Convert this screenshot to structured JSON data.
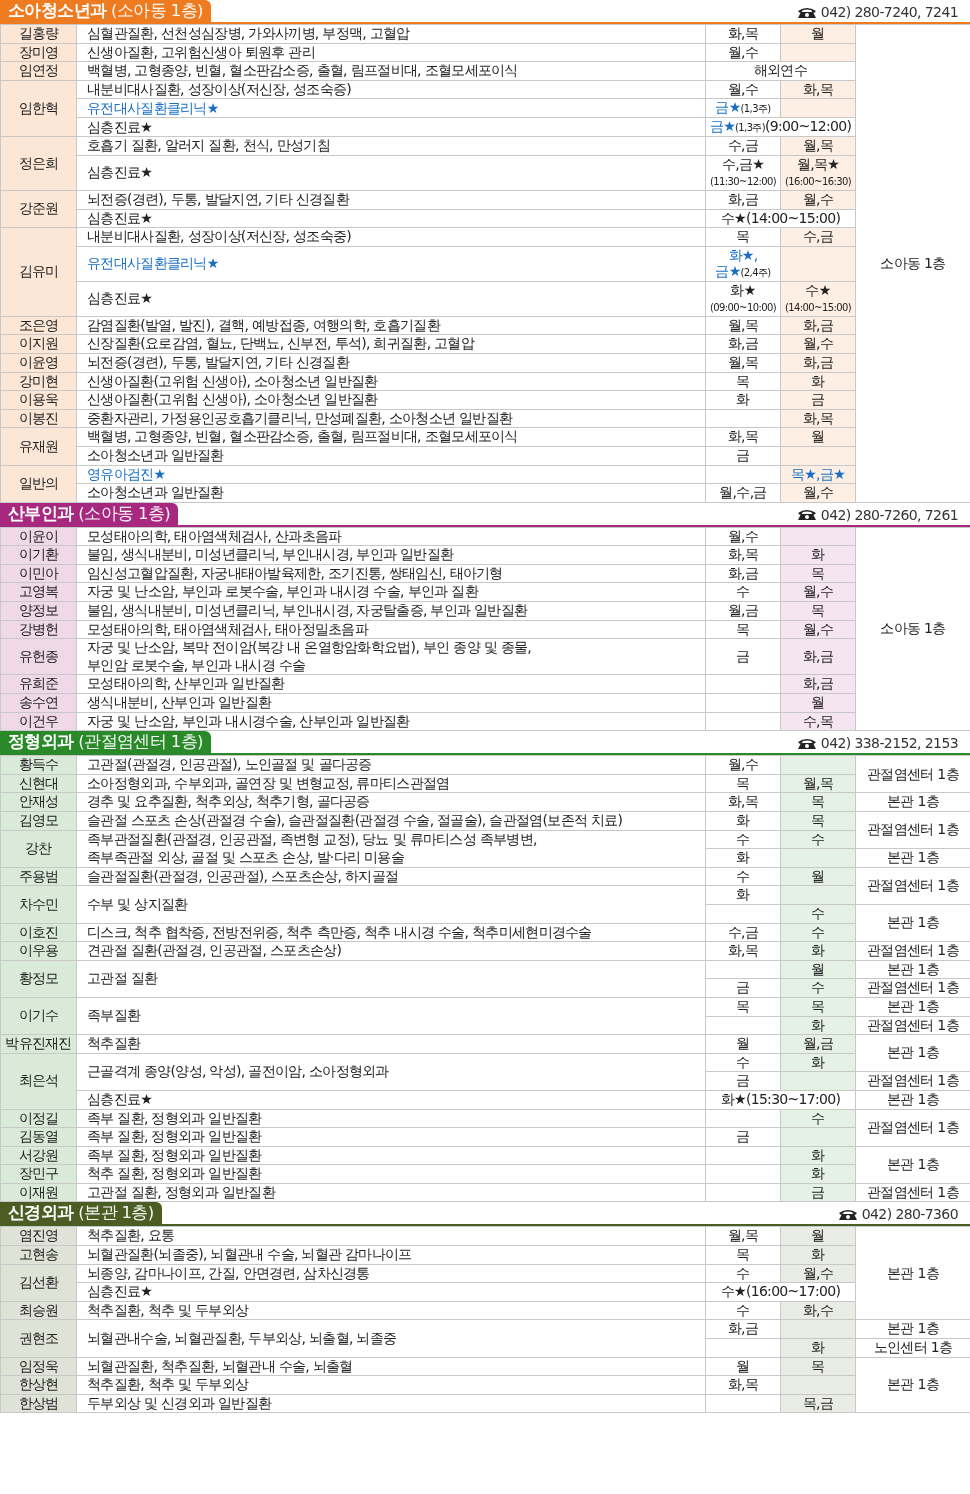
{
  "sections": [
    {
      "title": "소아청소년과",
      "floor": "(소아동 1층)",
      "phone": "042) 280-7240, 7241",
      "color": "#ef7b21",
      "doctors": [
        {
          "name": "길홍량",
          "topics": [
            {
              "text": "심혈관질환, 선천성심장병, 가와사끼병, 부정맥, 고혈압",
              "clinic": false,
              "slots": [
                {
                  "am": "화,목",
                  "pm": "월",
                  "location": "소아동 1층"
                }
              ]
            }
          ]
        },
        {
          "name": "장미영",
          "topics": [
            {
              "text": "신생아질환, 고위험신생아 퇴원후 관리",
              "clinic": false,
              "slots": [
                {
                  "am": "월,수"
                }
              ]
            }
          ]
        },
        {
          "name": "임연정",
          "topics": [
            {
              "text": "백혈병, 고형종양, 빈혈, 혈소판감소증, 출혈, 림프절비대, 조혈모세포이식",
              "clinic": false,
              "slots": [
                {
                  "both": "해외연수"
                }
              ]
            }
          ]
        },
        {
          "name": "임한혁",
          "topics": [
            {
              "text": "내분비대사질환, 성장이상(저신장, 성조숙증)",
              "clinic": false,
              "slots": [
                {
                  "am": "월,수",
                  "pm": "화,목"
                }
              ]
            },
            {
              "text": "유전대사질환클리닉★",
              "clinic": true,
              "slots": [
                {
                  "am": {
                    "lines": [
                      [
                        {
                          "text": "금★",
                          "kind": "blue"
                        },
                        {
                          "text": "(1,3주)",
                          "kind": "note"
                        }
                      ]
                    ]
                  }
                }
              ]
            },
            {
              "text": "심층진료★",
              "clinic": false,
              "slots": [
                {
                  "both": {
                    "lines": [
                      [
                        {
                          "text": "금★",
                          "kind": "blue"
                        },
                        {
                          "text": "(1,3주)",
                          "kind": "note"
                        },
                        {
                          "text": "(9:00~12:00)",
                          "kind": "plain"
                        }
                      ]
                    ]
                  }
                }
              ]
            }
          ]
        },
        {
          "name": "정은희",
          "topics": [
            {
              "text": "호흡기 질환, 알러지 질환, 천식, 만성기침",
              "clinic": false,
              "slots": [
                {
                  "am": "수,금",
                  "pm": "월,목"
                }
              ]
            },
            {
              "text": "심층진료★",
              "clinic": false,
              "slots": [
                {
                  "am": {
                    "lines": [
                      [
                        {
                          "text": "수,금★",
                          "kind": "plain"
                        }
                      ],
                      [
                        {
                          "text": "(11:30~12:00)",
                          "kind": "note"
                        }
                      ]
                    ]
                  },
                  "pm": {
                    "lines": [
                      [
                        {
                          "text": "월,목★",
                          "kind": "plain"
                        }
                      ],
                      [
                        {
                          "text": "(16:00~16:30)",
                          "kind": "note"
                        }
                      ]
                    ]
                  }
                }
              ]
            }
          ]
        },
        {
          "name": "강준원",
          "topics": [
            {
              "text": "뇌전증(경련), 두통, 발달지연, 기타 신경질환",
              "clinic": false,
              "slots": [
                {
                  "am": "화,금",
                  "pm": "월,수"
                }
              ]
            },
            {
              "text": "심층진료★",
              "clinic": false,
              "slots": [
                {
                  "both": "수★(14:00~15:00)"
                }
              ]
            }
          ]
        },
        {
          "name": "김유미",
          "topics": [
            {
              "text": "내분비대사질환, 성장이상(저신장, 성조숙중)",
              "clinic": false,
              "slots": [
                {
                  "am": "목",
                  "pm": "수,금"
                }
              ]
            },
            {
              "text": "유전대사질환클리닉★",
              "clinic": true,
              "slots": [
                {
                  "am": {
                    "lines": [
                      [
                        {
                          "text": "화★,",
                          "kind": "blue"
                        }
                      ],
                      [
                        {
                          "text": "금★",
                          "kind": "blue"
                        },
                        {
                          "text": "(2,4주)",
                          "kind": "note"
                        }
                      ]
                    ]
                  }
                }
              ]
            },
            {
              "text": "심층진료★",
              "clinic": false,
              "slots": [
                {
                  "am": {
                    "lines": [
                      [
                        {
                          "text": "화★",
                          "kind": "plain"
                        }
                      ],
                      [
                        {
                          "text": "(09:00~10:00)",
                          "kind": "note"
                        }
                      ]
                    ]
                  },
                  "pm": {
                    "lines": [
                      [
                        {
                          "text": "수★",
                          "kind": "plain"
                        }
                      ],
                      [
                        {
                          "text": "(14:00~15:00)",
                          "kind": "note"
                        }
                      ]
                    ]
                  }
                }
              ]
            }
          ]
        },
        {
          "name": "조은영",
          "topics": [
            {
              "text": "감염질환(발열, 발진), 결핵, 예방접종, 여행의학, 호흡기질환",
              "clinic": false,
              "slots": [
                {
                  "am": "월,목",
                  "pm": "화,금"
                }
              ]
            }
          ]
        },
        {
          "name": "이지원",
          "topics": [
            {
              "text": "신장질환(요로감염, 혈뇨, 단백뇨, 신부전, 투석), 희귀질환, 고혈압",
              "clinic": false,
              "slots": [
                {
                  "am": "화,금",
                  "pm": "월,수"
                }
              ]
            }
          ]
        },
        {
          "name": "이윤영",
          "topics": [
            {
              "text": "뇌전증(경련), 두통, 발달지연, 기타 신경질환",
              "clinic": false,
              "slots": [
                {
                  "am": "월,목",
                  "pm": "화,금"
                }
              ]
            }
          ]
        },
        {
          "name": "강미현",
          "topics": [
            {
              "text": "신생아질환(고위험 신생아), 소아청소년 일반질환",
              "clinic": false,
              "slots": [
                {
                  "am": "목",
                  "pm": "화"
                }
              ]
            }
          ]
        },
        {
          "name": "이용욱",
          "topics": [
            {
              "text": "신생아질환(고위험 신생아), 소아청소년 일반질환",
              "clinic": false,
              "slots": [
                {
                  "am": "화",
                  "pm": "금"
                }
              ]
            }
          ]
        },
        {
          "name": "이봉진",
          "topics": [
            {
              "text": "중환자관리, 가정용인공호흡기클리닉, 만성폐질환, 소아청소년 일반질환",
              "clinic": false,
              "slots": [
                {
                  "pm": "화,목"
                }
              ]
            }
          ]
        },
        {
          "name": "유재원",
          "topics": [
            {
              "text": "백혈병, 고형종양, 빈혈, 혈소판감소증, 출혈, 림프절비대, 조혈모세포이식",
              "clinic": false,
              "slots": [
                {
                  "am": "화,목",
                  "pm": "월"
                }
              ]
            },
            {
              "text": "소아청소년과 일반질환",
              "clinic": false,
              "slots": [
                {
                  "am": "금"
                }
              ]
            }
          ]
        },
        {
          "name": "일반의",
          "topics": [
            {
              "text": "영유아검진★",
              "clinic": true,
              "slots": [
                {
                  "pm": {
                    "lines": [
                      [
                        {
                          "text": "목★,금★",
                          "kind": "blue"
                        }
                      ]
                    ]
                  }
                }
              ]
            },
            {
              "text": "소아청소년과 일반질환",
              "clinic": false,
              "slots": [
                {
                  "am": "월,수,금",
                  "pm": "월,수"
                }
              ]
            }
          ]
        }
      ]
    },
    {
      "title": "산부인과",
      "floor": "(소아동 1층)",
      "phone": "042) 280-7260, 7261",
      "color": "#a6297f",
      "doctors": [
        {
          "name": "이윤이",
          "topics": [
            {
              "text": "모성태아의학, 태아염색체검사, 산과초음파",
              "clinic": false,
              "slots": [
                {
                  "am": "월,수",
                  "location": "소아동 1층"
                }
              ]
            }
          ]
        },
        {
          "name": "이기환",
          "topics": [
            {
              "text": "불임, 생식내분비, 미성년클리닉, 부인내시경, 부인과 일반질환",
              "clinic": false,
              "slots": [
                {
                  "am": "화,목",
                  "pm": "화"
                }
              ]
            }
          ]
        },
        {
          "name": "이민아",
          "topics": [
            {
              "text": "임신성고혈압질환, 자궁내태아발육제한, 조기진통, 쌍태임신, 태아기형",
              "clinic": false,
              "slots": [
                {
                  "am": "화,금",
                  "pm": "목"
                }
              ]
            }
          ]
        },
        {
          "name": "고영복",
          "topics": [
            {
              "text": "자궁 및 난소암, 부인과 로봇수술, 부인과 내시경 수술, 부인과 질환",
              "clinic": false,
              "slots": [
                {
                  "am": "수",
                  "pm": "월,수"
                }
              ]
            }
          ]
        },
        {
          "name": "양정보",
          "topics": [
            {
              "text": "불임, 생식내분비, 미성년클리닉, 부인내시경, 자궁탈출증, 부인과 일반질환",
              "clinic": false,
              "slots": [
                {
                  "am": "월,금",
                  "pm": "목"
                }
              ]
            }
          ]
        },
        {
          "name": "강병헌",
          "topics": [
            {
              "text": "모성태아의학, 태아염색체검사, 태아정밀초음파",
              "clinic": false,
              "slots": [
                {
                  "am": "목",
                  "pm": "월,수"
                }
              ]
            }
          ]
        },
        {
          "name": "유헌종",
          "topics": [
            {
              "text": "자궁 및 난소암, 복막 전이암(복강 내 온열항암화학요법), 부인 종양 및 종물,\n부인암 로봇수술, 부인과 내시경 수술",
              "clinic": false,
              "slots": [
                {
                  "am": "금",
                  "pm": "화,금"
                }
              ]
            }
          ]
        },
        {
          "name": "유희준",
          "topics": [
            {
              "text": "모성태아의학, 산부인과 일반질환",
              "clinic": false,
              "slots": [
                {
                  "pm": "화,금"
                }
              ]
            }
          ]
        },
        {
          "name": "송수연",
          "topics": [
            {
              "text": "생식내분비, 산부인과 일반질환",
              "clinic": false,
              "slots": [
                {
                  "pm": "월"
                }
              ]
            }
          ]
        },
        {
          "name": "이건우",
          "topics": [
            {
              "text": "자궁 및 난소암, 부인과 내시경수술, 산부인과 일반질환",
              "clinic": false,
              "slots": [
                {
                  "pm": "수,목"
                }
              ]
            }
          ]
        }
      ]
    },
    {
      "title": "정형외과",
      "floor": "(관절염센터 1층)",
      "phone": "042) 338-2152, 2153",
      "color": "#2a8a2a",
      "doctors": [
        {
          "name": "황득수",
          "topics": [
            {
              "text": "고관절(관절경, 인공관절), 노인골절 및 골다공증",
              "clinic": false,
              "slots": [
                {
                  "am": "월,수",
                  "location": "관절염센터 1층"
                }
              ]
            }
          ]
        },
        {
          "name": "신현대",
          "topics": [
            {
              "text": "소아정형외과, 수부외과, 골연장 및 변형교정, 류마티스관절염",
              "clinic": false,
              "slots": [
                {
                  "am": "목",
                  "pm": "월,목"
                }
              ]
            }
          ]
        },
        {
          "name": "안재성",
          "topics": [
            {
              "text": "경추 및 요추질환, 척추외상, 척추기형, 골다공증",
              "clinic": false,
              "slots": [
                {
                  "am": "화,목",
                  "pm": "목",
                  "location": "본관 1층"
                }
              ]
            }
          ]
        },
        {
          "name": "김영모",
          "topics": [
            {
              "text": "슬관절 스포츠 손상(관절경 수술), 슬관절질환(관절경 수술, 절골술), 슬관절염(보존적 치료)",
              "clinic": false,
              "slots": [
                {
                  "am": "화",
                  "pm": "목",
                  "location": "관절염센터 1층"
                }
              ]
            }
          ]
        },
        {
          "name": "강찬",
          "topics": [
            {
              "text": "족부관절질환(관절경, 인공관절, 족변형 교정), 당뇨 및 류마티스성 족부병변,\n족부족관절 외상, 골절 및 스포츠 손상, 발·다리 미용술",
              "clinic": false,
              "slots": [
                {
                  "am": "수",
                  "pm": "수"
                },
                {
                  "am": "화",
                  "location": "본관 1층"
                }
              ]
            }
          ]
        },
        {
          "name": "주용범",
          "topics": [
            {
              "text": "슬관절질환(관절경, 인공관절), 스포츠손상, 하지골절",
              "clinic": false,
              "slots": [
                {
                  "am": "수",
                  "pm": "월",
                  "location": "관절염센터 1층"
                }
              ]
            }
          ]
        },
        {
          "name": "차수민",
          "topics": [
            {
              "text": "수부 및 상지질환",
              "clinic": false,
              "slots": [
                {
                  "am": "화"
                },
                {
                  "pm": "수",
                  "location": "본관 1층"
                }
              ]
            }
          ]
        },
        {
          "name": "이호진",
          "topics": [
            {
              "text": "디스크, 척추 협착증, 전방전위증, 척추 측만증, 척추 내시경 수술, 척추미세현미경수술",
              "clinic": false,
              "slots": [
                {
                  "am": "수,금",
                  "pm": "수"
                }
              ]
            }
          ]
        },
        {
          "name": "이우용",
          "topics": [
            {
              "text": "견관절 질환(관절경, 인공관절, 스포츠손상)",
              "clinic": false,
              "slots": [
                {
                  "am": "화,목",
                  "pm": "화",
                  "location": "관절염센터 1층"
                }
              ]
            }
          ]
        },
        {
          "name": "황정모",
          "topics": [
            {
              "text": "고관절 질환",
              "clinic": false,
              "slots": [
                {
                  "pm": "월",
                  "location": "본관 1층"
                },
                {
                  "am": "금",
                  "pm": "수",
                  "location": "관절염센터 1층"
                }
              ]
            }
          ]
        },
        {
          "name": "이기수",
          "topics": [
            {
              "text": "족부질환",
              "clinic": false,
              "slots": [
                {
                  "am": "목",
                  "pm": "목",
                  "location": "본관 1층"
                },
                {
                  "pm": "화",
                  "location": "관절염센터 1층"
                }
              ]
            }
          ]
        },
        {
          "name": "박유진재진",
          "topics": [
            {
              "text": "척추질환",
              "clinic": false,
              "slots": [
                {
                  "am": "월",
                  "pm": "월,금",
                  "location": "본관 1층"
                }
              ]
            }
          ]
        },
        {
          "name": "최은석",
          "topics": [
            {
              "text": "근골격계 종양(양성, 악성), 골전이암, 소아정형외과",
              "clinic": false,
              "slots": [
                {
                  "am": "수",
                  "pm": "화"
                },
                {
                  "am": "금",
                  "location": "관절염센터 1층"
                }
              ]
            },
            {
              "text": "심층진료★",
              "clinic": false,
              "slots": [
                {
                  "both": "화★(15:30~17:00)",
                  "location": "본관 1층"
                }
              ]
            }
          ]
        },
        {
          "name": "이정길",
          "topics": [
            {
              "text": "족부 질환, 정형외과 일반질환",
              "clinic": false,
              "slots": [
                {
                  "pm": "수",
                  "location": "관절염센터 1층"
                }
              ]
            }
          ]
        },
        {
          "name": "김동열",
          "topics": [
            {
              "text": "족부 질환, 정형외과 일반질환",
              "clinic": false,
              "slots": [
                {
                  "am": "금"
                }
              ]
            }
          ]
        },
        {
          "name": "서강원",
          "topics": [
            {
              "text": "족부 질환, 정형외과 일반질환",
              "clinic": false,
              "slots": [
                {
                  "pm": "화",
                  "location": "본관 1층"
                }
              ]
            }
          ]
        },
        {
          "name": "장민구",
          "topics": [
            {
              "text": "척추 질환, 정형외과 일반질환",
              "clinic": false,
              "slots": [
                {
                  "pm": "화"
                }
              ]
            }
          ]
        },
        {
          "name": "이재원",
          "topics": [
            {
              "text": "고관절 질환, 정형외과 일반질환",
              "clinic": false,
              "slots": [
                {
                  "pm": "금",
                  "location": "관절염센터 1층"
                }
              ]
            }
          ]
        }
      ]
    },
    {
      "title": "신경외과",
      "floor": "(본관 1층)",
      "phone": "042) 280-7360",
      "color": "#4b5d22",
      "doctors": [
        {
          "name": "염진영",
          "topics": [
            {
              "text": "척추질환, 요통",
              "clinic": false,
              "slots": [
                {
                  "am": "월,목",
                  "pm": "월",
                  "location": "본관 1층"
                }
              ]
            }
          ]
        },
        {
          "name": "고현송",
          "topics": [
            {
              "text": "뇌혈관질환(뇌졸중), 뇌혈관내 수술, 뇌혈관 감마나이프",
              "clinic": false,
              "slots": [
                {
                  "am": "목",
                  "pm": "화"
                }
              ]
            }
          ]
        },
        {
          "name": "김선환",
          "topics": [
            {
              "text": "뇌종양, 감마나이프, 간질, 안면경련, 삼차신경통",
              "clinic": false,
              "slots": [
                {
                  "am": "수",
                  "pm": "월,수"
                }
              ]
            },
            {
              "text": "심층진료★",
              "clinic": false,
              "slots": [
                {
                  "both": "수★(16:00~17:00)"
                }
              ]
            }
          ]
        },
        {
          "name": "최승원",
          "topics": [
            {
              "text": "척추질환, 척추 및 두부외상",
              "clinic": false,
              "slots": [
                {
                  "am": "수",
                  "pm": "화,수"
                }
              ]
            }
          ]
        },
        {
          "name": "권현조",
          "topics": [
            {
              "text": "뇌혈관내수술, 뇌혈관질환, 두부외상, 뇌출혈, 뇌졸중",
              "clinic": false,
              "slots": [
                {
                  "am": "화,금",
                  "location": "본관 1층"
                },
                {
                  "pm": "화",
                  "location": "노인센터 1층"
                }
              ]
            }
          ]
        },
        {
          "name": "임정욱",
          "topics": [
            {
              "text": "뇌혈관질환, 척추질환, 뇌혈관내 수술, 뇌출혈",
              "clinic": false,
              "slots": [
                {
                  "am": "월",
                  "pm": "목",
                  "location": "본관 1층"
                }
              ]
            }
          ]
        },
        {
          "name": "한상현",
          "topics": [
            {
              "text": "척추질환, 척추 및 두부외상",
              "clinic": false,
              "slots": [
                {
                  "am": "화,목"
                }
              ]
            }
          ]
        },
        {
          "name": "한상범",
          "topics": [
            {
              "text": "두부외상 및 신경외과 일반질환",
              "clinic": false,
              "slots": [
                {
                  "pm": "목,금"
                }
              ]
            }
          ]
        }
      ]
    }
  ]
}
